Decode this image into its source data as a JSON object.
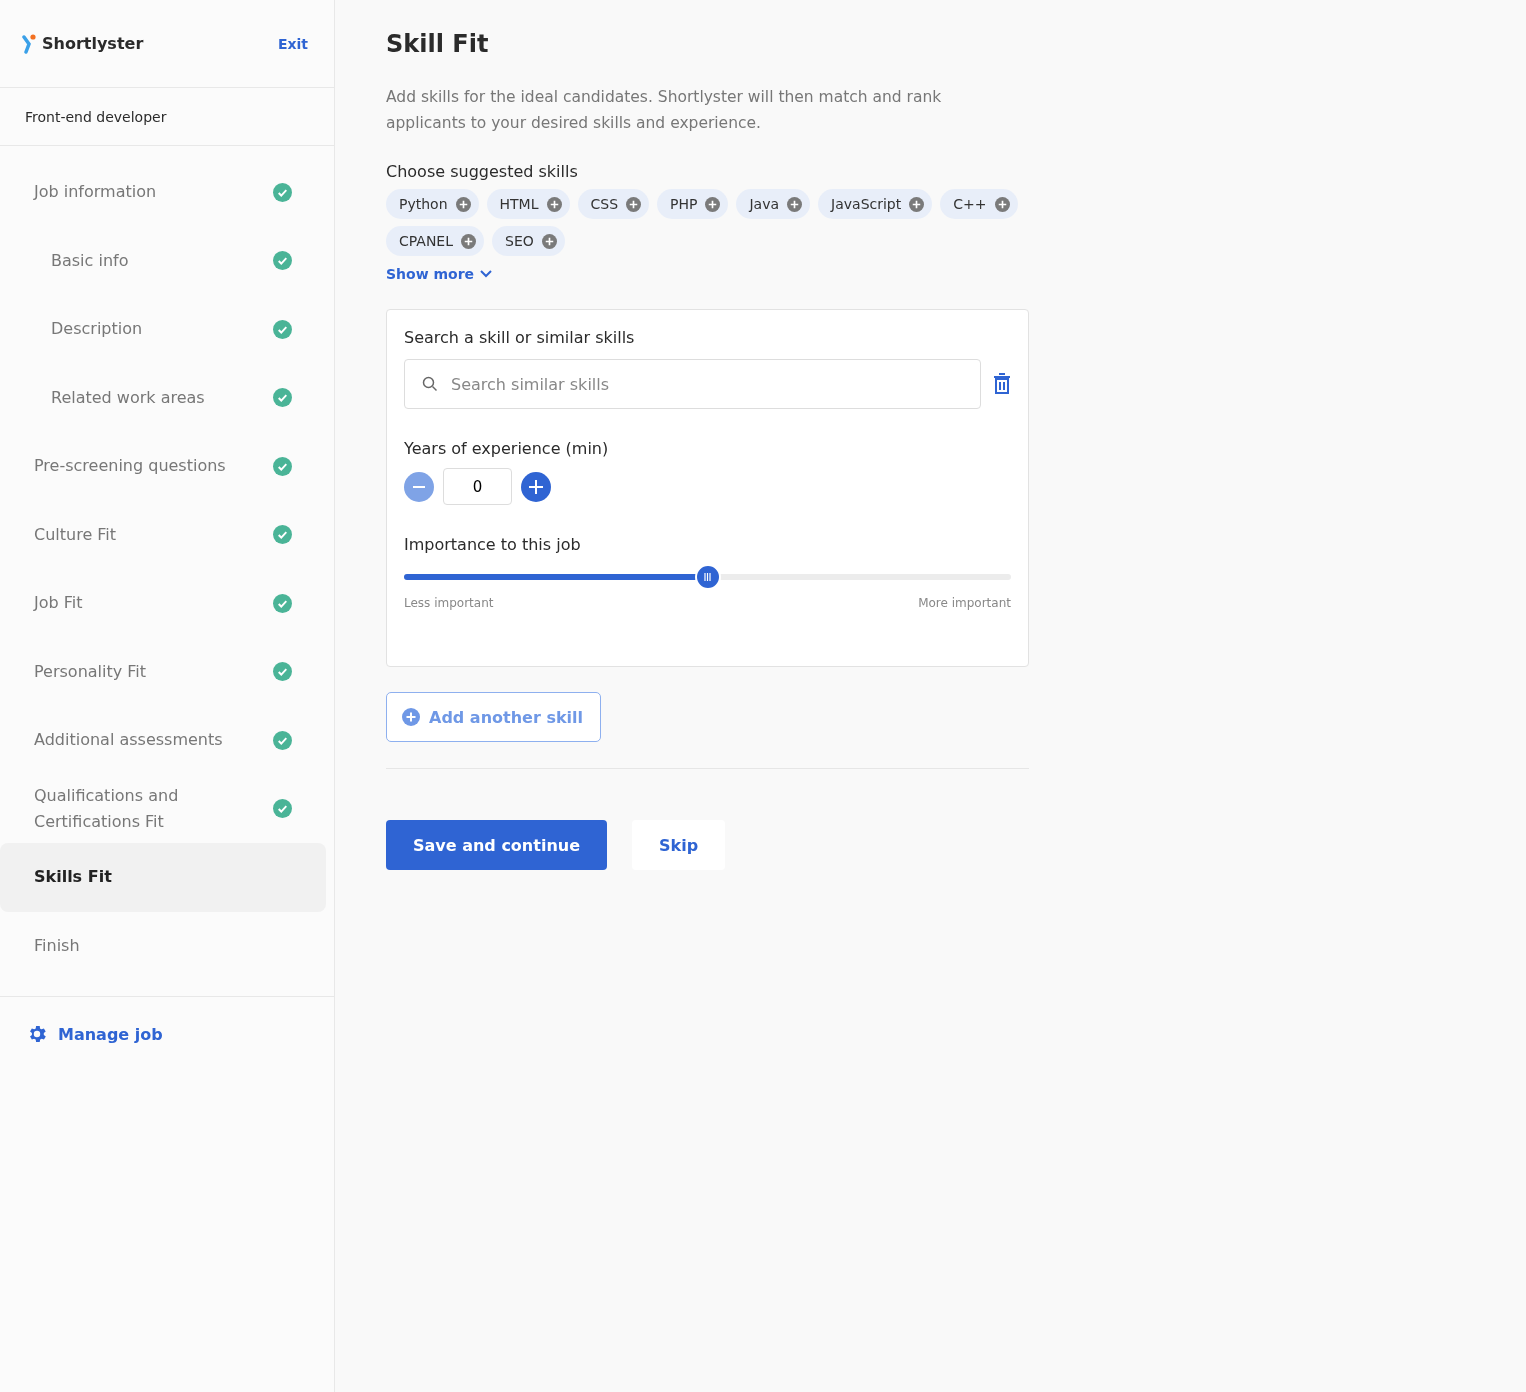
{
  "sidebar": {
    "brand": "Shortlyster",
    "exit": "Exit",
    "job_title": "Front-end developer",
    "steps": [
      {
        "label": "Job information",
        "done": true,
        "selected": false,
        "children": [
          {
            "label": "Basic info",
            "done": true,
            "selected": false
          },
          {
            "label": "Description",
            "done": true,
            "selected": false
          },
          {
            "label": "Related work areas",
            "done": true,
            "selected": false
          }
        ]
      },
      {
        "label": "Pre-screening questions",
        "done": true,
        "selected": false
      },
      {
        "label": "Culture Fit",
        "done": true,
        "selected": false
      },
      {
        "label": "Job Fit",
        "done": true,
        "selected": false
      },
      {
        "label": "Personality Fit",
        "done": true,
        "selected": false
      },
      {
        "label": "Additional assessments",
        "done": true,
        "selected": false
      },
      {
        "label": "Qualifications and Certifications Fit",
        "done": true,
        "selected": false
      },
      {
        "label": "Skills Fit",
        "done": false,
        "selected": true
      },
      {
        "label": "Finish",
        "done": false,
        "selected": false
      }
    ],
    "manage": "Manage job"
  },
  "main": {
    "title": "Skill Fit",
    "intro": "Add skills for the ideal candidates. Shortlyster will then match and rank applicants to your desired skills and experience.",
    "suggested_label": "Choose suggested skills",
    "suggested": [
      "Python",
      "HTML",
      "CSS",
      "PHP",
      "Java",
      "JavaScript",
      "C++",
      "CPANEL",
      "SEO"
    ],
    "show_more": "Show more",
    "skill_card": {
      "search_label": "Search a skill or similar skills",
      "search_placeholder": "Search similar skills",
      "years_label": "Years of experience (min)",
      "years_value": "0",
      "minus_disabled": true,
      "importance_label": "Importance to this job",
      "level": 0.5,
      "min_label": "Less important",
      "max_label": "More important"
    },
    "add_skill": {
      "label": "Add another skill",
      "disabled": true
    },
    "save": "Save and continue",
    "skip": "Skip"
  }
}
